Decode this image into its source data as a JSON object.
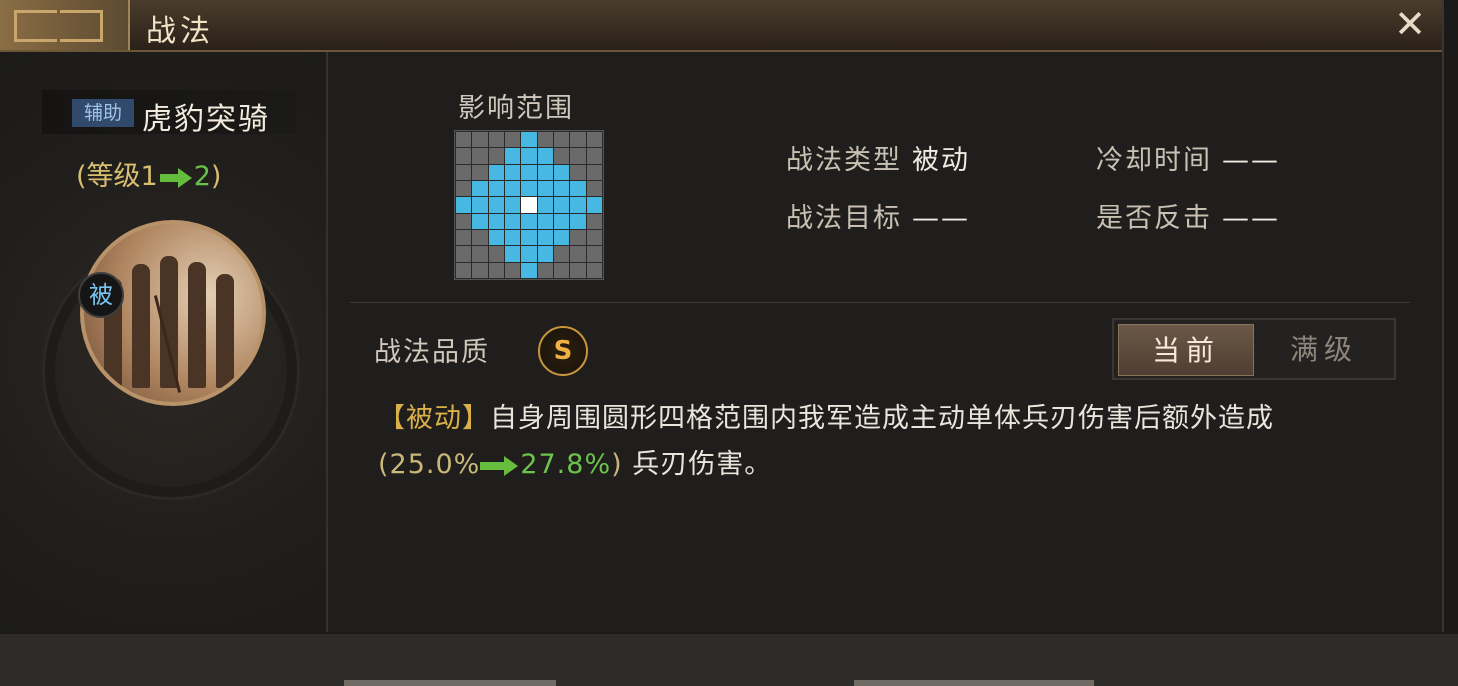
{
  "window": {
    "title": "战法",
    "close_label": "✕"
  },
  "skill": {
    "tag": "辅助",
    "name": "虎豹突骑",
    "level_prefix": "(等级",
    "level_from": "1",
    "level_to": "2",
    "level_suffix": ")",
    "badge": "被"
  },
  "range": {
    "label": "影响范围",
    "grid_size": 9,
    "pattern": [
      "000010000",
      "000111000",
      "001111100",
      "011111110",
      "111121111",
      "011111110",
      "001111100",
      "000111000",
      "000010000"
    ]
  },
  "info": {
    "type_label": "战法类型",
    "type_value": "被动",
    "cooldown_label": "冷却时间",
    "cooldown_value": "——",
    "target_label": "战法目标",
    "target_value": "——",
    "counter_label": "是否反击",
    "counter_value": "——"
  },
  "quality": {
    "label": "战法品质",
    "grade": "S"
  },
  "toggle": {
    "current": "当前",
    "max": "满级",
    "selected": "current"
  },
  "description": {
    "bracket": "【被动】",
    "text1": "自身周围圆形四格范围内我军造成主动单体兵刃伤害后额外造成",
    "open": "(",
    "old": "25.0%",
    "new": "27.8%",
    "close": ")",
    "text2": " 兵刃伤害。"
  },
  "colors": {
    "grid_on": "#46b8e2",
    "grid_off": "#6a6a6a",
    "accent_green": "#66bc3c",
    "gold": "#d9b04a"
  }
}
